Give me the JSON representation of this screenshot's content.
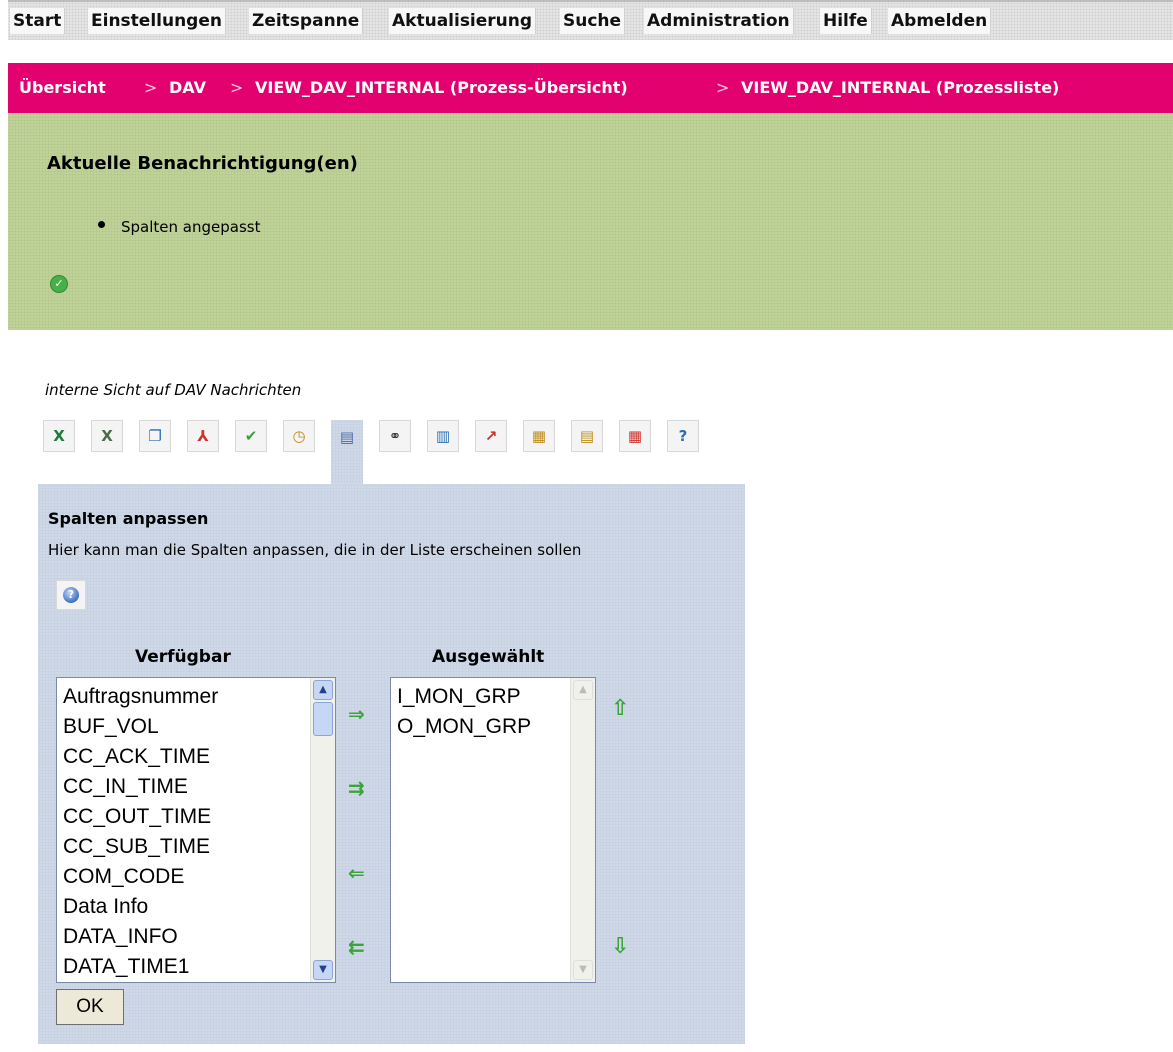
{
  "menu": {
    "items": [
      "Start",
      "Einstellungen",
      "Zeitspanne",
      "Aktualisierung",
      "Suche",
      "Administration",
      "Hilfe",
      "Abmelden"
    ]
  },
  "breadcrumb": {
    "items": [
      "Übersicht",
      "DAV",
      "VIEW_DAV_INTERNAL (Prozess-Übersicht)",
      "VIEW_DAV_INTERNAL (Prozessliste)"
    ],
    "separator": ">"
  },
  "notification": {
    "title": "Aktuelle Benachrichtigung(en)",
    "message": "Spalten angepasst",
    "status_icon": "check-circle-icon"
  },
  "view": {
    "subtitle": "interne Sicht auf DAV Nachrichten"
  },
  "toolbar": {
    "tools": [
      {
        "name": "excel-export-icon",
        "glyph": "X",
        "color": "#1f7a3a"
      },
      {
        "name": "excel-list-icon",
        "glyph": "X",
        "color": "#4a6b4a"
      },
      {
        "name": "html-export-icon",
        "glyph": "❐",
        "color": "#2a6fb8"
      },
      {
        "name": "pdf-export-icon",
        "glyph": "⅄",
        "color": "#d0312d"
      },
      {
        "name": "checkmark-icon",
        "glyph": "✔",
        "color": "#3aa43a"
      },
      {
        "name": "clock-icon",
        "glyph": "◷",
        "color": "#c08a18"
      },
      {
        "name": "columns-icon",
        "glyph": "▤",
        "color": "#4a6aa8"
      },
      {
        "name": "binoculars-icon",
        "glyph": "⚭",
        "color": "#333333"
      },
      {
        "name": "bar-chart-icon",
        "glyph": "▥",
        "color": "#2a6fb8"
      },
      {
        "name": "line-chart-icon",
        "glyph": "↗",
        "color": "#d0312d"
      },
      {
        "name": "calendar-icon",
        "glyph": "▦",
        "color": "#c08a18"
      },
      {
        "name": "table-icon",
        "glyph": "▤",
        "color": "#c08a18"
      },
      {
        "name": "table-filter-icon",
        "glyph": "▦",
        "color": "#d0312d"
      },
      {
        "name": "help-icon",
        "glyph": "?",
        "color": "#2a6fb8"
      }
    ],
    "active_index": 6
  },
  "panel": {
    "title": "Spalten anpassen",
    "description": "Hier kann man die Spalten anpassen, die in der Liste erscheinen sollen",
    "available_label": "Verfügbar",
    "selected_label": "Ausgewählt",
    "available": [
      "Auftragsnummer",
      "BUF_VOL",
      "CC_ACK_TIME",
      "CC_IN_TIME",
      "CC_OUT_TIME",
      "CC_SUB_TIME",
      "COM_CODE",
      "Data Info",
      "DATA_INFO",
      "DATA_TIME1"
    ],
    "selected": [
      "I_MON_GRP",
      "O_MON_GRP"
    ],
    "ok_label": "OK",
    "arrows": {
      "add": "⇒",
      "add_all": "⇉",
      "remove": "⇐",
      "remove_all": "⇇",
      "up": "⇧",
      "down": "⇩"
    }
  }
}
